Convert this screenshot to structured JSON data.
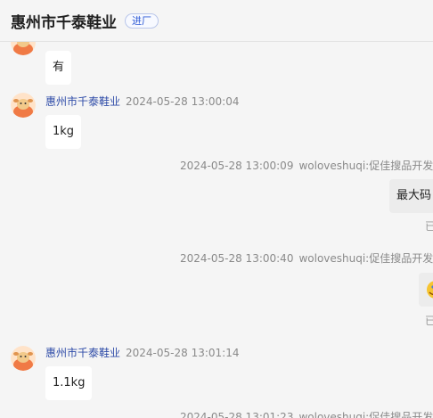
{
  "header": {
    "title": "惠州市千泰鞋业",
    "badge": "进厂"
  },
  "messages": [
    {
      "type": "in",
      "text": "有"
    },
    {
      "type": "in",
      "sender": "惠州市千泰鞋业",
      "time": "2024-05-28 13:00:04",
      "text": "1kg"
    },
    {
      "type": "out",
      "time": "2024-05-28 13:00:09",
      "sender": "woloveshuqi:促佳搜品开发部",
      "text": "最大码",
      "status": "已"
    },
    {
      "type": "out",
      "time": "2024-05-28 13:00:40",
      "sender": "woloveshuqi:促佳搜品开发部",
      "emoji": "smiling-emoji",
      "status": "已"
    },
    {
      "type": "in",
      "sender": "惠州市千泰鞋业",
      "time": "2024-05-28 13:01:14",
      "text": "1.1kg"
    },
    {
      "type": "out",
      "time": "2024-05-28 13:01:23",
      "sender": "woloveshuqi:促佳搜品开发部"
    }
  ],
  "colors": {
    "accent": "#2f4ca8",
    "avatar": "#f08a4b"
  }
}
